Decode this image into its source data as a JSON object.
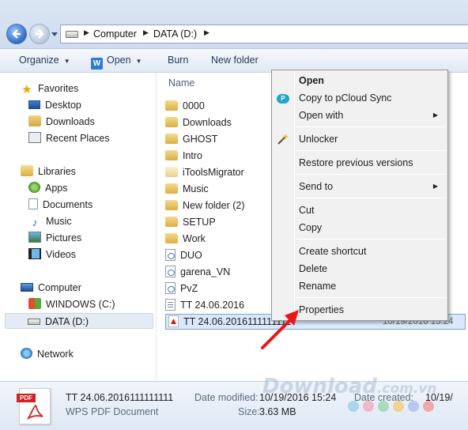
{
  "address_bar": {
    "crumbs": [
      "Computer",
      "DATA (D:)"
    ]
  },
  "toolbar": {
    "organize": "Organize",
    "open": "Open",
    "burn": "Burn",
    "new_folder": "New folder"
  },
  "navigation": {
    "favorites": {
      "label": "Favorites",
      "items": [
        "Desktop",
        "Downloads",
        "Recent Places"
      ]
    },
    "libraries": {
      "label": "Libraries",
      "items": [
        "Apps",
        "Documents",
        "Music",
        "Pictures",
        "Videos"
      ]
    },
    "computer": {
      "label": "Computer",
      "items": [
        "WINDOWS (C:)",
        "DATA (D:)"
      ],
      "selected": "DATA (D:)"
    },
    "network": {
      "label": "Network"
    }
  },
  "file_list": {
    "column_name": "Name",
    "items": [
      {
        "name": "0000",
        "type": "folder"
      },
      {
        "name": "Downloads",
        "type": "folder"
      },
      {
        "name": "GHOST",
        "type": "folder"
      },
      {
        "name": "Intro",
        "type": "folder"
      },
      {
        "name": "iToolsMigrator",
        "type": "folder-light"
      },
      {
        "name": "Music",
        "type": "folder"
      },
      {
        "name": "New folder (2)",
        "type": "folder"
      },
      {
        "name": "SETUP",
        "type": "folder"
      },
      {
        "name": "Work",
        "type": "folder"
      },
      {
        "name": "DUO",
        "type": "app"
      },
      {
        "name": "garena_VN",
        "type": "app"
      },
      {
        "name": "PvZ",
        "type": "app"
      },
      {
        "name": "TT 24.06.2016",
        "type": "doc"
      },
      {
        "name": "TT 24.06.2016111111111",
        "type": "pdf",
        "selected": true,
        "date": "10/19/2016 15:24"
      }
    ]
  },
  "context_menu": {
    "items": [
      {
        "label": "Open",
        "bold": true
      },
      {
        "label": "Copy to pCloud Sync",
        "icon": "pcloud-icon"
      },
      {
        "label": "Open with",
        "submenu": true
      },
      {
        "separator": true
      },
      {
        "label": "Unlocker",
        "icon": "unlocker-wand-icon"
      },
      {
        "separator": true
      },
      {
        "label": "Restore previous versions"
      },
      {
        "separator": true
      },
      {
        "label": "Send to",
        "submenu": true
      },
      {
        "separator": true
      },
      {
        "label": "Cut"
      },
      {
        "label": "Copy"
      },
      {
        "separator": true
      },
      {
        "label": "Create shortcut"
      },
      {
        "label": "Delete"
      },
      {
        "label": "Rename"
      },
      {
        "separator": true
      },
      {
        "label": "Properties",
        "highlighted_by_arrow": true
      }
    ],
    "pcloud_icon_letter": "P"
  },
  "details_pane": {
    "file_name": "TT 24.06.2016111111111",
    "file_type": "WPS PDF Document",
    "date_modified_label": "Date modified:",
    "date_modified": "10/19/2016 15:24",
    "date_created_label": "Date created:",
    "date_created": "10/19/",
    "size_label": "Size:",
    "size": "3.63 MB",
    "pdf_tag": "PDF"
  },
  "watermark": {
    "text_main": "Download",
    "text_suffix": ".com.vn",
    "dot_colors": [
      "#8ecbe8",
      "#f3a1b6",
      "#8fd19e",
      "#f7c66b",
      "#9fb8f0",
      "#f08c8c"
    ]
  },
  "colors": {
    "annotation_arrow": "#e8161a",
    "selection_fill": "#d9e8fb",
    "selection_border": "#7da2ce"
  }
}
